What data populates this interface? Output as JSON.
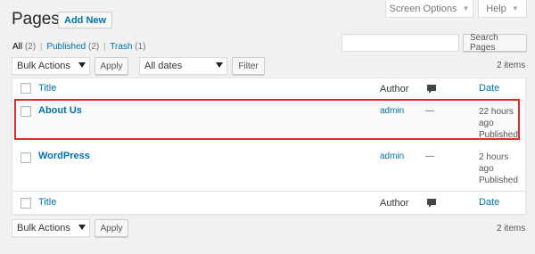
{
  "screen_options": {
    "label": "Screen Options"
  },
  "help": {
    "label": "Help"
  },
  "header": {
    "title": "Pages",
    "add_new_label": "Add New"
  },
  "filters": {
    "links": [
      {
        "label": "All",
        "count": "(2)"
      },
      {
        "label": "Published",
        "count": "(2)"
      },
      {
        "label": "Trash",
        "count": "(1)"
      }
    ],
    "separator": "|"
  },
  "search": {
    "button_label": "Search Pages",
    "value": ""
  },
  "top_nav": {
    "bulk_actions": "Bulk Actions",
    "apply_label": "Apply",
    "date_filter": "All dates",
    "filter_label": "Filter",
    "items_count": "2 items"
  },
  "table": {
    "columns": {
      "title": "Title",
      "author": "Author",
      "comments_icon": "comment-bubble-icon",
      "date": "Date"
    },
    "rows": [
      {
        "title": "About Us",
        "author": "admin",
        "comments": "—",
        "date_line1": "22 hours",
        "date_line2": "ago",
        "status": "Published"
      },
      {
        "title": "WordPress",
        "author": "admin",
        "comments": "—",
        "date_line1": "2 hours",
        "date_line2": "ago",
        "status": "Published"
      }
    ],
    "footer": {
      "title": "Title",
      "author": "Author",
      "date": "Date"
    }
  },
  "bottom_nav": {
    "bulk_actions": "Bulk Actions",
    "apply_label": "Apply",
    "items_count": "2 items"
  },
  "colors": {
    "link": "#0073aa",
    "highlight": "#d62f2f",
    "background": "#f1f1f1"
  }
}
